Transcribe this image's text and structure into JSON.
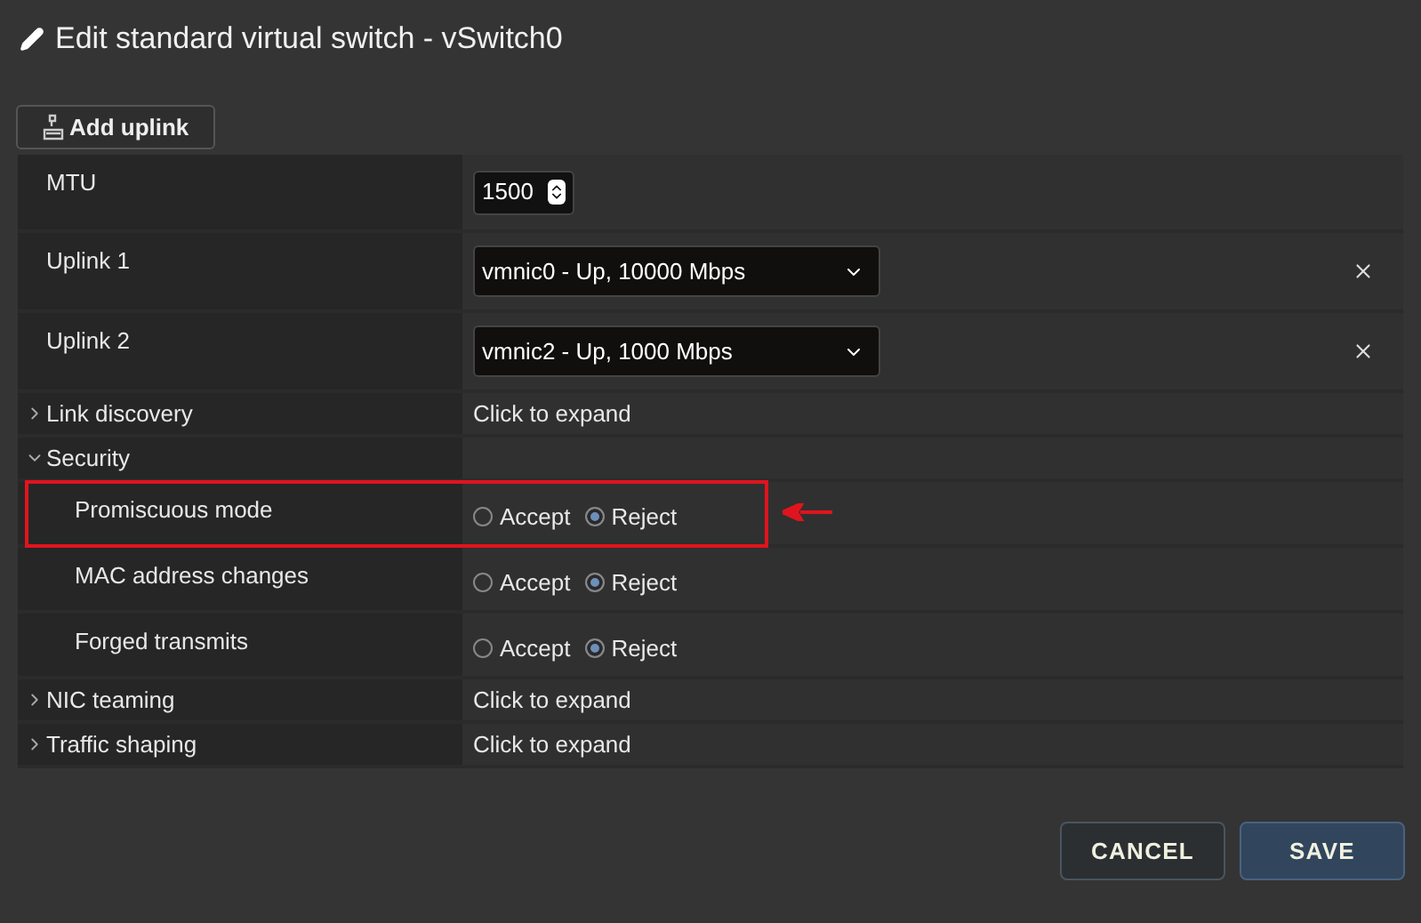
{
  "dialog": {
    "title": "Edit standard virtual switch - vSwitch0"
  },
  "toolbar": {
    "add_uplink": "Add uplink"
  },
  "rows": [
    {
      "kind": "number",
      "label": "MTU",
      "value": "1500"
    },
    {
      "kind": "select",
      "label": "Uplink 1",
      "value": "vmnic0 - Up, 10000 Mbps"
    },
    {
      "kind": "select",
      "label": "Uplink 2",
      "value": "vmnic2 - Up, 1000 Mbps"
    },
    {
      "kind": "group",
      "label": "Link discovery",
      "expanded": false,
      "summary": "Click to expand"
    },
    {
      "kind": "group",
      "label": "Security",
      "expanded": true,
      "children": [
        {
          "kind": "radio",
          "label": "Promiscuous mode",
          "highlighted": true,
          "options": [
            {
              "label": "Accept",
              "selected": false
            },
            {
              "label": "Reject",
              "selected": true
            }
          ]
        },
        {
          "kind": "radio",
          "label": "MAC address changes",
          "highlighted": false,
          "options": [
            {
              "label": "Accept",
              "selected": false
            },
            {
              "label": "Reject",
              "selected": true
            }
          ]
        },
        {
          "kind": "radio",
          "label": "Forged transmits",
          "highlighted": false,
          "options": [
            {
              "label": "Accept",
              "selected": false
            },
            {
              "label": "Reject",
              "selected": true
            }
          ]
        }
      ]
    },
    {
      "kind": "group",
      "label": "NIC teaming",
      "expanded": false,
      "summary": "Click to expand"
    },
    {
      "kind": "group",
      "label": "Traffic shaping",
      "expanded": false,
      "summary": "Click to expand"
    }
  ],
  "buttons": [
    {
      "kind": "secondary",
      "label": "CANCEL"
    },
    {
      "kind": "primary",
      "label": "SAVE"
    }
  ]
}
